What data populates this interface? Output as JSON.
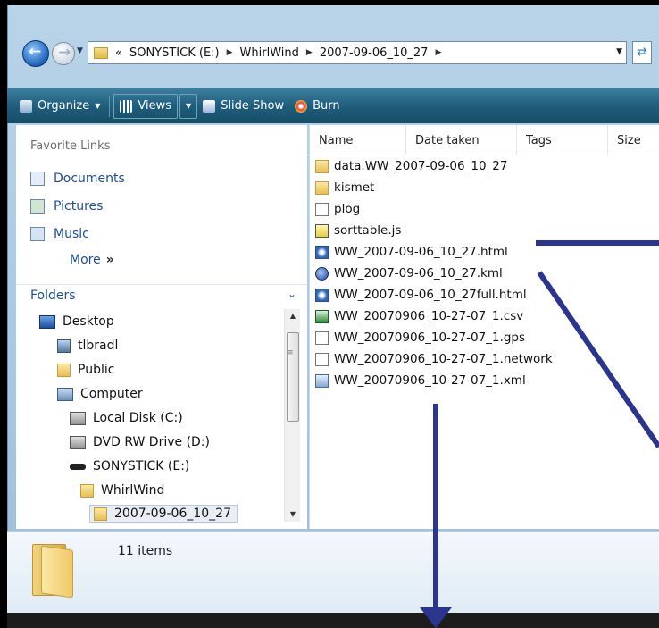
{
  "address": {
    "overflow": "«",
    "crumbs": [
      "SONYSTICK (E:)",
      "WhirlWind",
      "2007-09-06_10_27"
    ]
  },
  "toolbar": {
    "organize": "Organize",
    "views": "Views",
    "slideshow": "Slide Show",
    "burn": "Burn"
  },
  "nav": {
    "favorites_heading": "Favorite Links",
    "favorites": [
      "Documents",
      "Pictures",
      "Music"
    ],
    "more": "More",
    "folders_heading": "Folders",
    "tree": [
      "Desktop",
      "tlbradl",
      "Public",
      "Computer",
      "Local Disk (C:)",
      "DVD RW Drive (D:)",
      "SONYSTICK (E:)",
      "WhirlWind",
      "2007-09-06_10_27"
    ]
  },
  "columns": [
    "Name",
    "Date taken",
    "Tags",
    "Size"
  ],
  "files": [
    {
      "name": "data.WW_2007-09-06_10_27",
      "icon": "folder-icon"
    },
    {
      "name": "kismet",
      "icon": "folder-icon"
    },
    {
      "name": "plog",
      "icon": "document-icon"
    },
    {
      "name": "sorttable.js",
      "icon": "script-icon"
    },
    {
      "name": "WW_2007-09-06_10_27.html",
      "icon": "html-icon"
    },
    {
      "name": "WW_2007-09-06_10_27.kml",
      "icon": "kml-globe-icon"
    },
    {
      "name": "WW_2007-09-06_10_27full.html",
      "icon": "html-icon"
    },
    {
      "name": "WW_20070906_10-27-07_1.csv",
      "icon": "spreadsheet-icon"
    },
    {
      "name": "WW_20070906_10-27-07_1.gps",
      "icon": "document-icon"
    },
    {
      "name": "WW_20070906_10-27-07_1.network",
      "icon": "document-icon"
    },
    {
      "name": "WW_20070906_10-27-07_1.xml",
      "icon": "xml-icon"
    }
  ],
  "details": {
    "item_count": "11 items"
  },
  "colors": {
    "annotation": "#2b3590",
    "toolbar": "#1f5e7c",
    "link": "#1e4d99"
  }
}
